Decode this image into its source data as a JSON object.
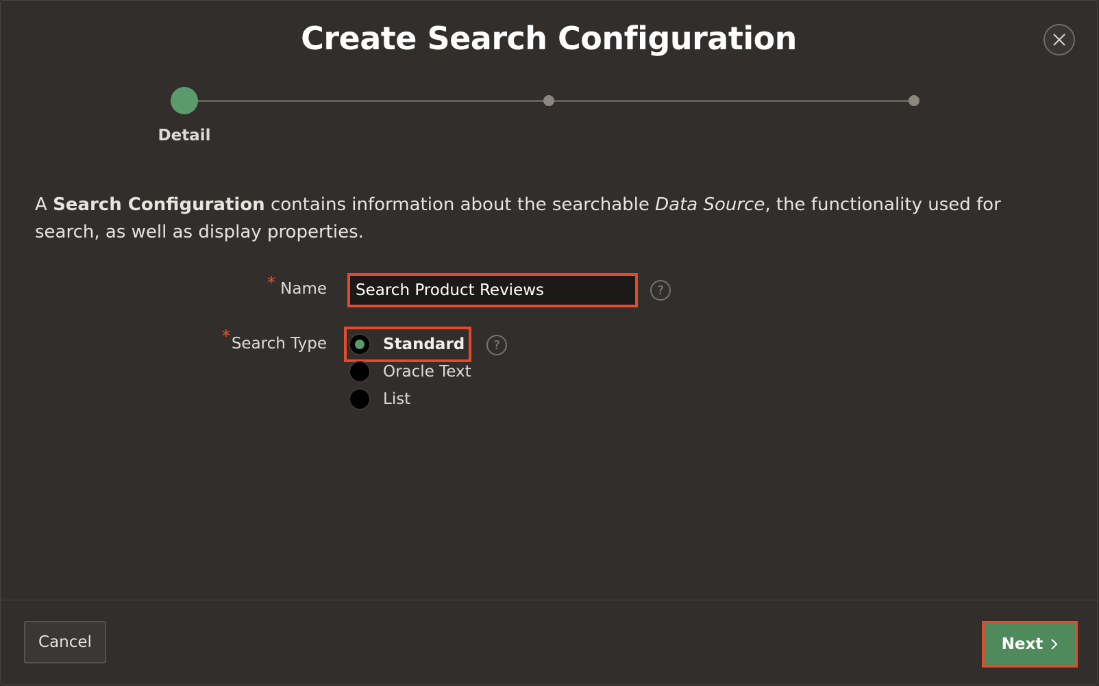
{
  "dialog": {
    "title": "Create Search Configuration",
    "close_icon": "close-icon"
  },
  "wizard": {
    "steps": [
      {
        "label": "Detail",
        "state": "current"
      },
      {
        "label": "",
        "state": "pending"
      },
      {
        "label": "",
        "state": "pending"
      }
    ]
  },
  "intro": {
    "prefix": "A ",
    "term": "Search Configuration",
    "middle": " contains information about the searchable ",
    "data_source": "Data Source",
    "suffix": ", the functionality used for search, as well as display properties."
  },
  "form": {
    "name": {
      "required_marker": "*",
      "label": "Name",
      "value": "Search Product Reviews",
      "help_icon": "help-icon"
    },
    "search_type": {
      "required_marker": "*",
      "label": "Search Type",
      "selected": "Standard",
      "options": [
        "Standard",
        "Oracle Text",
        "List"
      ],
      "help_icon": "help-icon"
    }
  },
  "footer": {
    "cancel_label": "Cancel",
    "next_label": "Next",
    "next_icon": "chevron-right-icon"
  },
  "colors": {
    "background": "#322e2b",
    "accent_green": "#5a9a6b",
    "highlight_red": "#e34b2c",
    "required_red": "#e2553b"
  }
}
